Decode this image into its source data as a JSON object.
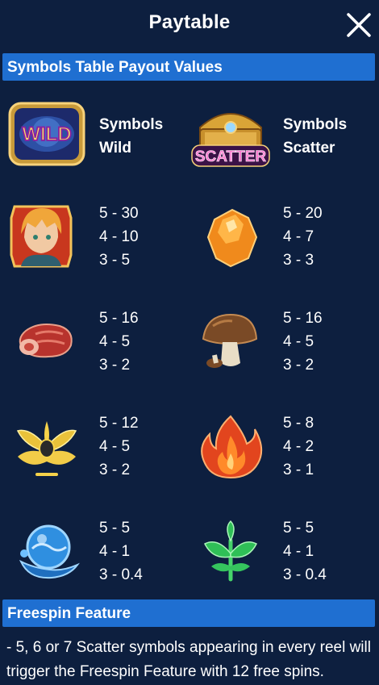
{
  "header": {
    "title": "Paytable"
  },
  "sections": {
    "symbols_title": "Symbols Table Payout Values",
    "freespin_title": "Freespin Feature"
  },
  "specials": {
    "wild": {
      "badge": "WILD",
      "line1": "Symbols",
      "line2": "Wild"
    },
    "scatter": {
      "badge": "SCATTER",
      "line1": "Symbols",
      "line2": "Scatter"
    }
  },
  "symbols": [
    {
      "icon": "hero-icon",
      "pays": [
        "5 - 30",
        "4 - 10",
        "3 - 5"
      ]
    },
    {
      "icon": "amber-gem-icon",
      "pays": [
        "5 - 20",
        "4 - 7",
        "3 - 3"
      ]
    },
    {
      "icon": "meat-icon",
      "pays": [
        "5 - 16",
        "4 - 5",
        "3 - 2"
      ]
    },
    {
      "icon": "mushroom-icon",
      "pays": [
        "5 - 16",
        "4 - 5",
        "3 - 2"
      ]
    },
    {
      "icon": "gold-leaf-icon",
      "pays": [
        "5 - 12",
        "4 - 5",
        "3 - 2"
      ]
    },
    {
      "icon": "fire-icon",
      "pays": [
        "5 - 8",
        "4 - 2",
        "3 - 1"
      ]
    },
    {
      "icon": "water-orb-icon",
      "pays": [
        "5 - 5",
        "4 - 1",
        "3 - 0.4"
      ]
    },
    {
      "icon": "green-leaf-icon",
      "pays": [
        "5 - 5",
        "4 - 1",
        "3 - 0.4"
      ]
    }
  ],
  "freespin": {
    "description": "- 5, 6 or 7 Scatter symbols appearing in every reel will trigger the Freespin Feature with 12 free spins."
  }
}
